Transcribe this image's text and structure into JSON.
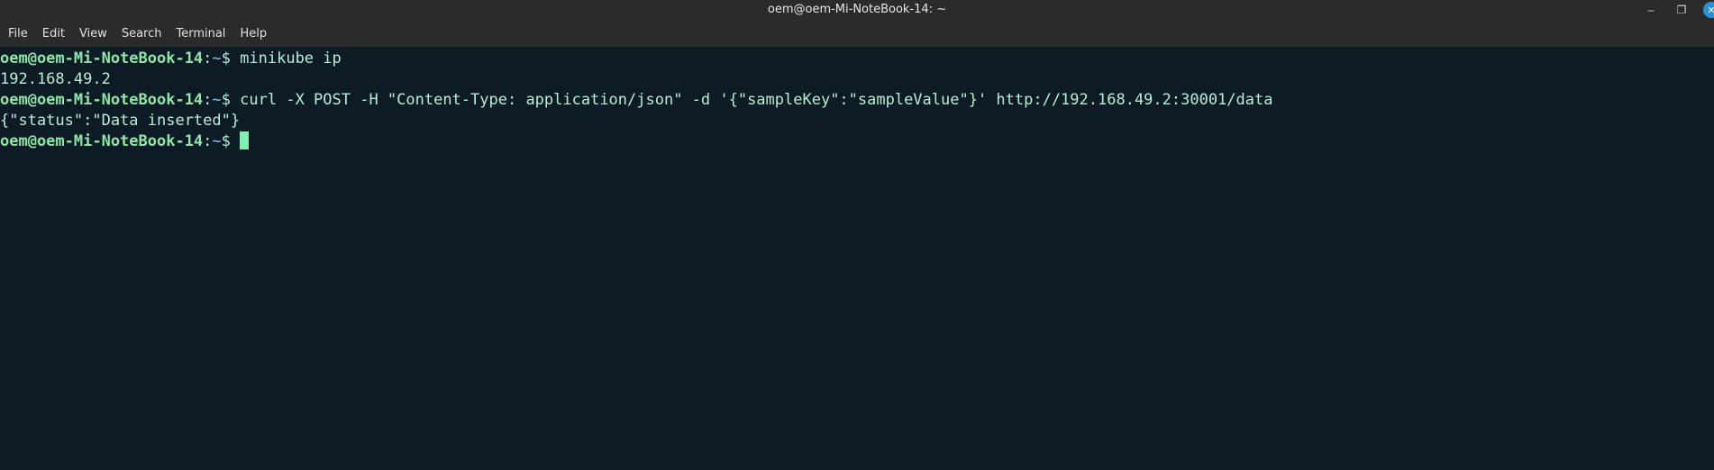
{
  "window": {
    "title": "oem@oem-Mi-NoteBook-14: ~",
    "controls": {
      "minimize": "–",
      "maximize": "❐",
      "close": "✕"
    }
  },
  "menu": {
    "items": [
      "File",
      "Edit",
      "View",
      "Search",
      "Terminal",
      "Help"
    ]
  },
  "terminal": {
    "prompt_user": "oem@oem-Mi-NoteBook-14",
    "prompt_colon": ":",
    "prompt_path": "~",
    "prompt_dollar": "$",
    "lines": [
      {
        "type": "prompt",
        "command": " minikube ip"
      },
      {
        "type": "output",
        "text": "192.168.49.2"
      },
      {
        "type": "prompt",
        "command": " curl -X POST -H \"Content-Type: application/json\" -d '{\"sampleKey\":\"sampleValue\"}' http://192.168.49.2:30001/data"
      },
      {
        "type": "output",
        "text": "{\"status\":\"Data inserted\"}"
      },
      {
        "type": "prompt",
        "command": " "
      }
    ]
  },
  "colors": {
    "background": "#0d1c24",
    "titlebar": "#2b2b2b",
    "prompt_user": "#8ee5a8",
    "text": "#b7ecd7",
    "cursor": "#7ff0b0",
    "close_button": "#2a8fd6"
  }
}
